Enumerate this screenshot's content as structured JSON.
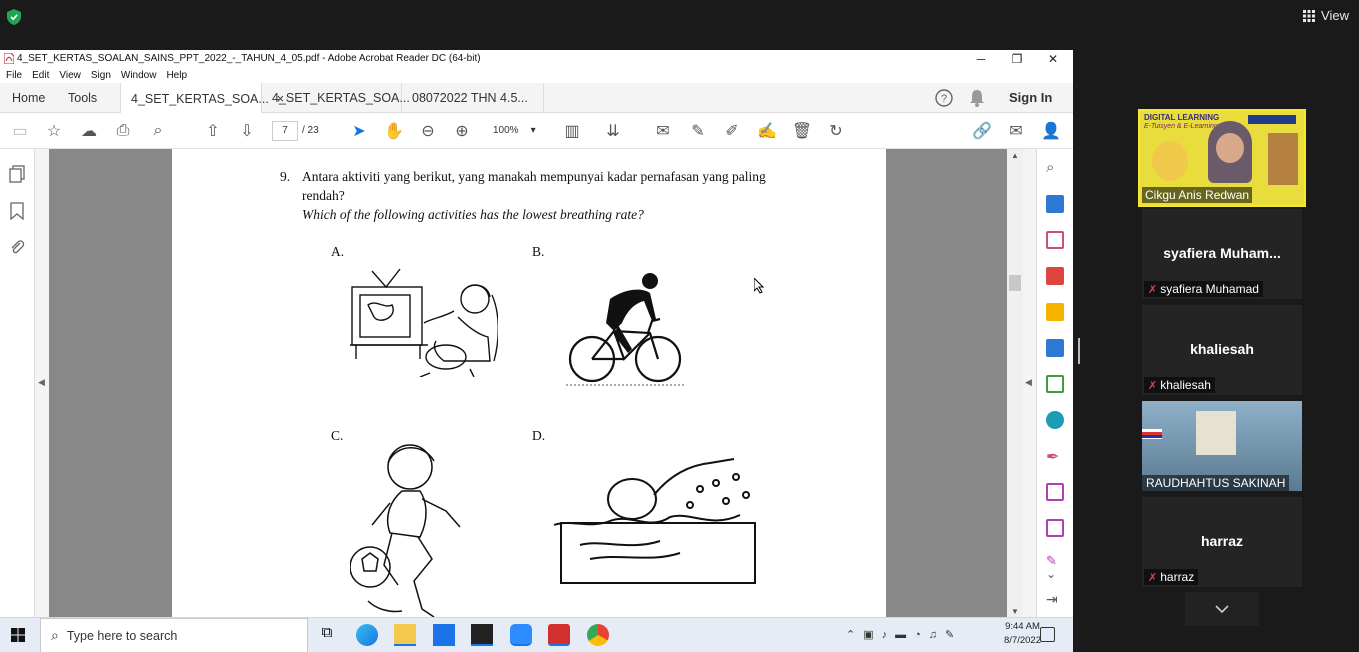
{
  "zoom": {
    "view_label": "View"
  },
  "window": {
    "title": "4_SET_KERTAS_SOALAN_SAINS_PPT_2022_-_TAHUN_4_05.pdf - Adobe Acrobat Reader DC (64-bit)",
    "menu": [
      "File",
      "Edit",
      "View",
      "Sign",
      "Window",
      "Help"
    ]
  },
  "tabs": {
    "home": "Home",
    "tools": "Tools",
    "doc1": "4_SET_KERTAS_SOA...",
    "doc1_close": "×",
    "doc2": "4_SET_KERTAS_SOA...",
    "doc3": "08072022 THN 4.5...",
    "sign_in": "Sign In"
  },
  "toolbar": {
    "page_current": "7",
    "page_total": "/ 23",
    "zoom": "100%"
  },
  "question": {
    "number": "9.",
    "malay_line1": "Antara aktiviti yang berikut, yang manakah mempunyai kadar pernafasan yang paling",
    "malay_line2": "rendah?",
    "english": "Which of the following activities has the lowest breathing rate?",
    "options": {
      "a": "A.",
      "b": "B.",
      "c": "C.",
      "d": "D."
    }
  },
  "taskbar": {
    "search_placeholder": "Type here to search",
    "time": "9:44 AM",
    "date": "8/7/2022"
  },
  "participants": {
    "p1": "Cikgu Anis Redwan",
    "p2_name": "syafiera  Muham...",
    "p2_label": "syafiera Muhamad",
    "p3_name": "khaliesah",
    "p3_label": "khaliesah",
    "p4_label": "RAUDHAHTUS SAKINAH",
    "p5_name": "harraz",
    "p5_label": "harraz"
  },
  "banner_text": {
    "line1": "DIGITAL LEARNING",
    "line2": "E-Tuisyen & E-Learning"
  },
  "colors": {
    "acrobat_red": "#d32f2f",
    "zoom_bg": "#1a1a1a",
    "taskbar": "#e5ecf5",
    "accent_blue": "#1473e6"
  }
}
